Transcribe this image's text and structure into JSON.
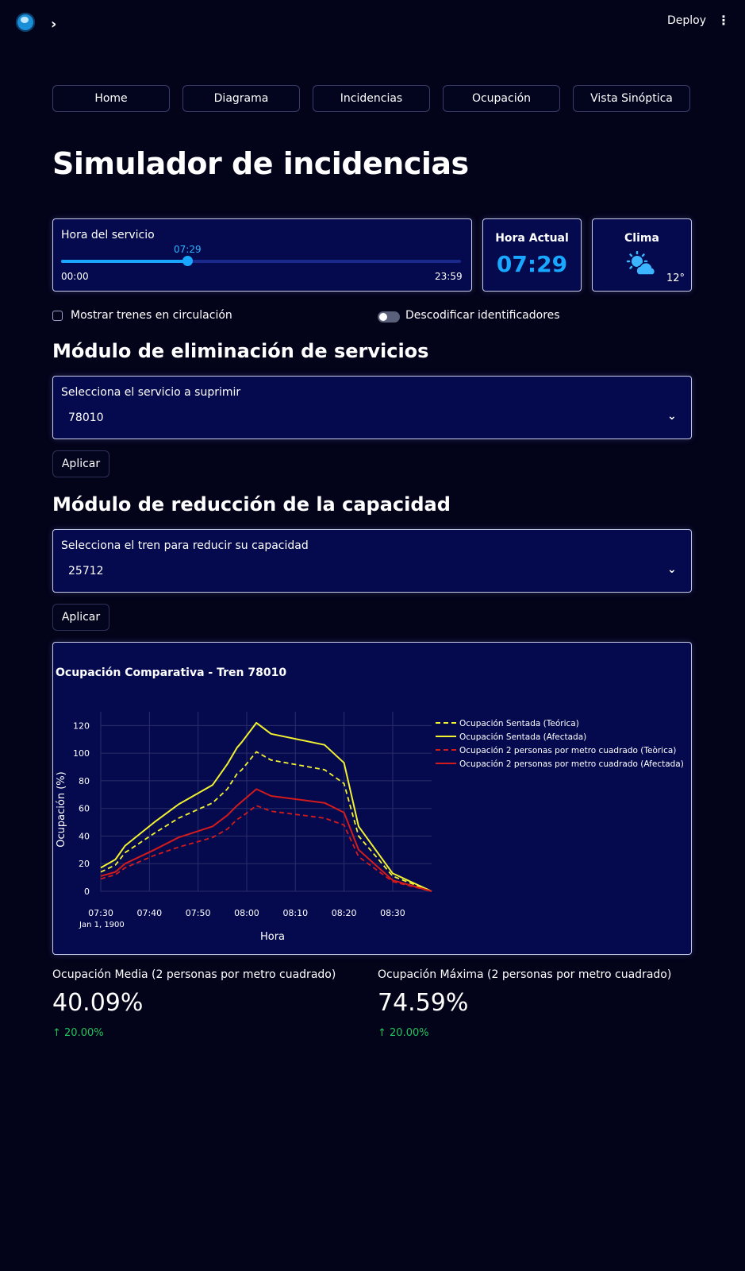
{
  "header": {
    "deploy_label": "Deploy",
    "menu_icon": "kebab-menu-icon",
    "expand_icon": "chevron-right-icon"
  },
  "nav": {
    "tabs": [
      {
        "label": "Home"
      },
      {
        "label": "Diagrama"
      },
      {
        "label": "Incidencias"
      },
      {
        "label": "Ocupación"
      },
      {
        "label": "Vista Sinóptica"
      }
    ]
  },
  "page": {
    "title": "Simulador de incidencias"
  },
  "service_time": {
    "label": "Hora del servicio",
    "value": "07:29",
    "min": "00:00",
    "max": "23:59",
    "value_fraction": 0.312
  },
  "current_time": {
    "title": "Hora Actual",
    "value": "07:29"
  },
  "weather": {
    "title": "Clima",
    "temperature": "12°",
    "icon": "partly-cloudy-sun-icon"
  },
  "options": {
    "show_trains_label": "Mostrar trenes en circulación",
    "show_trains_checked": false,
    "decode_label": "Descodificar identificadores",
    "decode_on": false
  },
  "removal_module": {
    "heading": "Módulo de eliminación de servicios",
    "select_label": "Selecciona el servicio a suprimir",
    "selected": "78010",
    "apply_label": "Aplicar"
  },
  "capacity_module": {
    "heading": "Módulo de reducción de la capacidad",
    "select_label": "Selecciona el tren para reducir su capacidad",
    "selected": "25712",
    "apply_label": "Aplicar"
  },
  "chart_data": {
    "type": "line",
    "title": "Ocupación Comparativa - Tren 78010",
    "xlabel": "Hora",
    "ylabel": "Ocupación (%)",
    "x_ticks": [
      "07:30",
      "07:40",
      "07:50",
      "08:00",
      "08:10",
      "08:20",
      "08:30"
    ],
    "x_tick_sublabel": "Jan 1, 1900",
    "ylim": [
      0,
      130
    ],
    "y_ticks": [
      0,
      20,
      40,
      60,
      80,
      100,
      120
    ],
    "grid": true,
    "legend_position": "right",
    "x": [
      "07:30",
      "07:33",
      "07:35",
      "07:41",
      "07:46",
      "07:53",
      "07:56",
      "07:58",
      "07:59",
      "08:02",
      "08:05",
      "08:16",
      "08:20",
      "08:23",
      "08:30",
      "08:38"
    ],
    "series": [
      {
        "name": "Ocupación Sentada (Teórica)",
        "color": "#f2f230",
        "dash": "dashed",
        "values": [
          14,
          19,
          28,
          42,
          53,
          64,
          74,
          85,
          88,
          101,
          95,
          88,
          78,
          40,
          11,
          0
        ]
      },
      {
        "name": "Ocupación Sentada (Afectada)",
        "color": "#f2f230",
        "dash": "solid",
        "values": [
          17,
          23,
          33,
          50,
          63,
          77,
          92,
          104,
          108,
          122,
          114,
          106,
          93,
          47,
          13,
          0
        ]
      },
      {
        "name": "Ocupación 2 personas por metro cuadrado (Teòrica)",
        "color": "#d31b1b",
        "dash": "dashed",
        "values": [
          9,
          12,
          17,
          26,
          32,
          39,
          45,
          52,
          54,
          62,
          58,
          53,
          48,
          25,
          7,
          0
        ]
      },
      {
        "name": "Ocupación 2 personas por metro cuadrado (Afectada)",
        "color": "#d31b1b",
        "dash": "solid",
        "values": [
          11,
          14,
          20,
          30,
          39,
          47,
          55,
          62,
          65,
          74,
          69,
          64,
          57,
          30,
          8,
          0
        ]
      }
    ]
  },
  "metrics": [
    {
      "label": "Ocupación Media (2 personas por metro cuadrado)",
      "value": "40.09%",
      "delta": "20.00%"
    },
    {
      "label": "Ocupación Máxima (2 personas por metro cuadrado)",
      "value": "74.59%",
      "delta": "20.00%"
    }
  ],
  "colors": {
    "background": "#03031a",
    "card": "#050a4e",
    "accent": "#18a8ff",
    "delta_up": "#21c35c"
  }
}
